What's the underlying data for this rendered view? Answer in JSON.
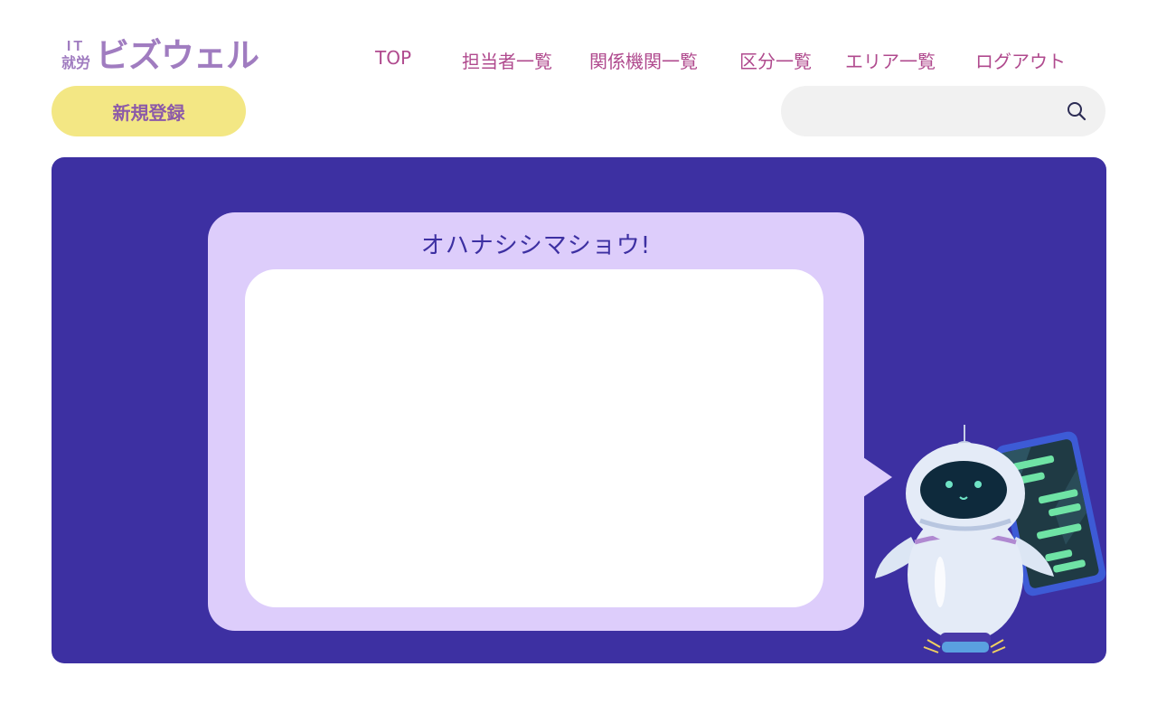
{
  "header": {
    "logo_it": "IT",
    "logo_shuro": "就労",
    "logo_name": "ビズウェル"
  },
  "nav": {
    "items": [
      {
        "label": "TOP"
      },
      {
        "label": "担当者一覧"
      },
      {
        "label": "関係機関一覧"
      },
      {
        "label": "区分一覧"
      },
      {
        "label": "エリア一覧"
      },
      {
        "label": "ログアウト"
      }
    ]
  },
  "toolbar": {
    "register_label": "新規登録"
  },
  "search": {
    "value": "",
    "placeholder": "",
    "icon": "search-icon"
  },
  "chat": {
    "title": "オハナシシマショウ!",
    "message": ""
  },
  "colors": {
    "accent_purple": "#a07cc0",
    "nav_text": "#b04a8e",
    "button_yellow": "#f3e784",
    "panel_bg": "#3d30a2",
    "bubble_bg": "#ddcdfb"
  }
}
